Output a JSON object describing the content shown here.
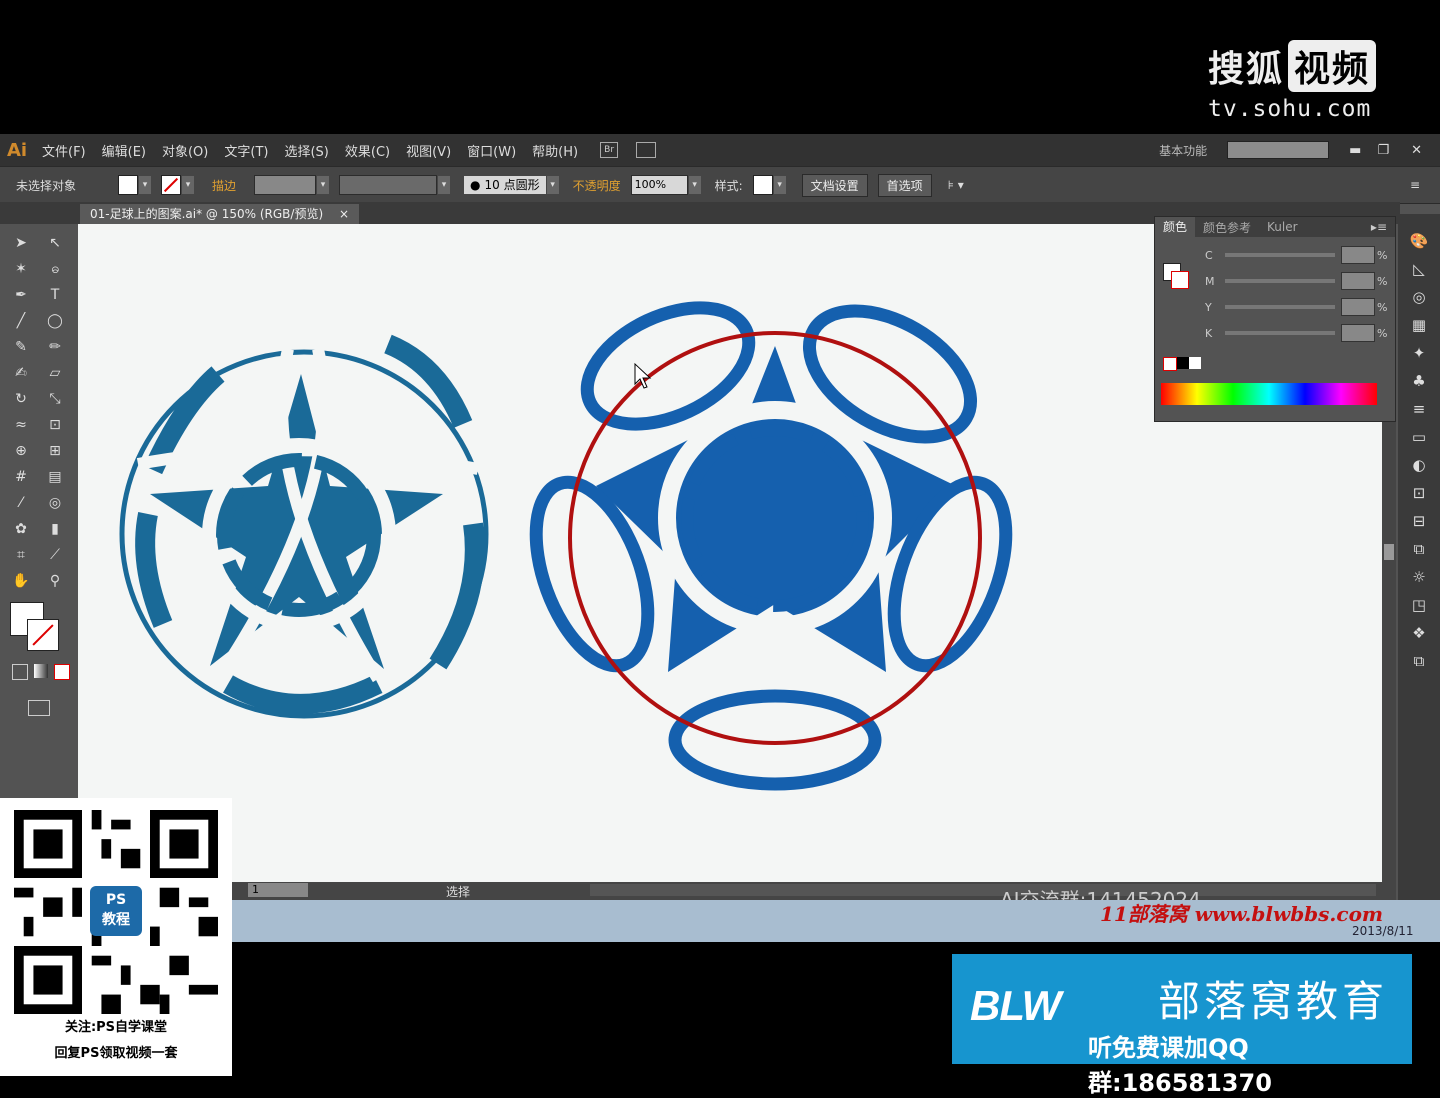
{
  "watermark": {
    "brand_text": "搜狐",
    "brand_box": "视频",
    "url": "tv.sohu.com"
  },
  "app": {
    "logo": "Ai"
  },
  "menu": [
    "文件(F)",
    "编辑(E)",
    "对象(O)",
    "文字(T)",
    "选择(S)",
    "效果(C)",
    "视图(V)",
    "窗口(W)",
    "帮助(H)"
  ],
  "workspace": {
    "label": "基本功能"
  },
  "control_bar": {
    "selection_label": "未选择对象",
    "stroke_label": "描边",
    "brush_label": "10 点圆形",
    "opacity_label": "不透明度",
    "opacity_value": "100%",
    "style_label": "样式:",
    "doc_setup_button": "文档设置",
    "prefs_button": "首选项"
  },
  "document_tab": {
    "title": "01-足球上的图案.ai* @ 150% (RGB/预览)",
    "close": "×"
  },
  "color_panel": {
    "tabs": [
      "颜色",
      "颜色参考",
      "Kuler"
    ],
    "channels": [
      "C",
      "M",
      "Y",
      "K"
    ],
    "unit": "%"
  },
  "status_bar": {
    "zoom": "1",
    "mode": "选择"
  },
  "overlay": {
    "ai_group": "AI交流群:141452024",
    "blog": "11部落窝 www.blwbbs.com",
    "date": "2013/8/11"
  },
  "qr_promo": {
    "badge_line1": "PS",
    "badge_line2": "教程",
    "line1": "关注:PS自学课堂",
    "line2": "回复PS领取视频一套"
  },
  "blw_banner": {
    "logo": "BLW",
    "name": "部落窝教育",
    "qq": "听免费课加QQ群:186581370"
  },
  "colors": {
    "ball_left": "#1a6a98",
    "ball_right": "#1560ae",
    "guide_circle": "#b01010",
    "canvas": "#f4f6f5"
  },
  "icons": [
    "selection-tool-icon",
    "direct-selection-tool-icon",
    "magic-wand-icon",
    "lasso-icon",
    "pen-tool-icon",
    "type-tool-icon",
    "line-tool-icon",
    "ellipse-tool-icon",
    "paintbrush-icon",
    "pencil-icon",
    "blob-brush-icon",
    "eraser-icon",
    "rotate-icon",
    "scale-icon",
    "warp-icon",
    "free-transform-icon",
    "shape-builder-icon",
    "perspective-grid-icon",
    "mesh-icon",
    "gradient-icon",
    "eyedropper-icon",
    "blend-icon",
    "symbol-sprayer-icon",
    "column-graph-icon",
    "artboard-icon",
    "slice-icon",
    "hand-icon",
    "zoom-icon"
  ]
}
